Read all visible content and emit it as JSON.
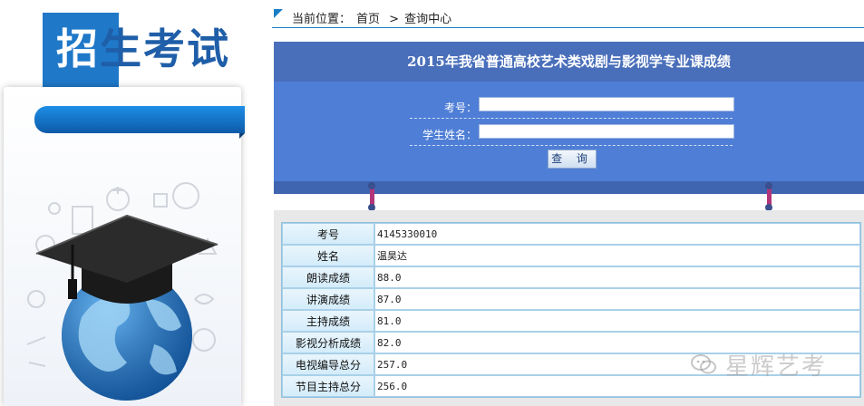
{
  "banner": {
    "logo_first_char": "招",
    "logo_rest": "生考试"
  },
  "breadcrumb": {
    "label": "当前位置：",
    "home": "首页",
    "separator": ">",
    "current": "查询中心"
  },
  "query": {
    "title": "2015年我省普通高校艺术类戏剧与影视学专业课成绩",
    "exam_no_label": "考号：",
    "exam_no_value": "",
    "name_label": "学生姓名：",
    "name_value": "",
    "submit_label": "查 询"
  },
  "results": [
    {
      "key": "考号",
      "value": "4145330010"
    },
    {
      "key": "姓名",
      "value": "温昊达"
    },
    {
      "key": "朗读成绩",
      "value": "88.0"
    },
    {
      "key": "讲演成绩",
      "value": "87.0"
    },
    {
      "key": "主持成绩",
      "value": "81.0"
    },
    {
      "key": "影视分析成绩",
      "value": "82.0"
    },
    {
      "key": "电视编导总分",
      "value": "257.0"
    },
    {
      "key": "节目主持总分",
      "value": "256.0"
    }
  ],
  "watermark": {
    "icon": "wechat-icon",
    "text": "星辉艺考"
  },
  "colors": {
    "accent_blue": "#1f78c8",
    "panel_blue": "#4f7ed6",
    "title_bar": "#4a6fba",
    "table_border": "#a9d0e8"
  },
  "icons": [
    "graduation-cap-icon",
    "globe-icon",
    "wechat-icon"
  ]
}
